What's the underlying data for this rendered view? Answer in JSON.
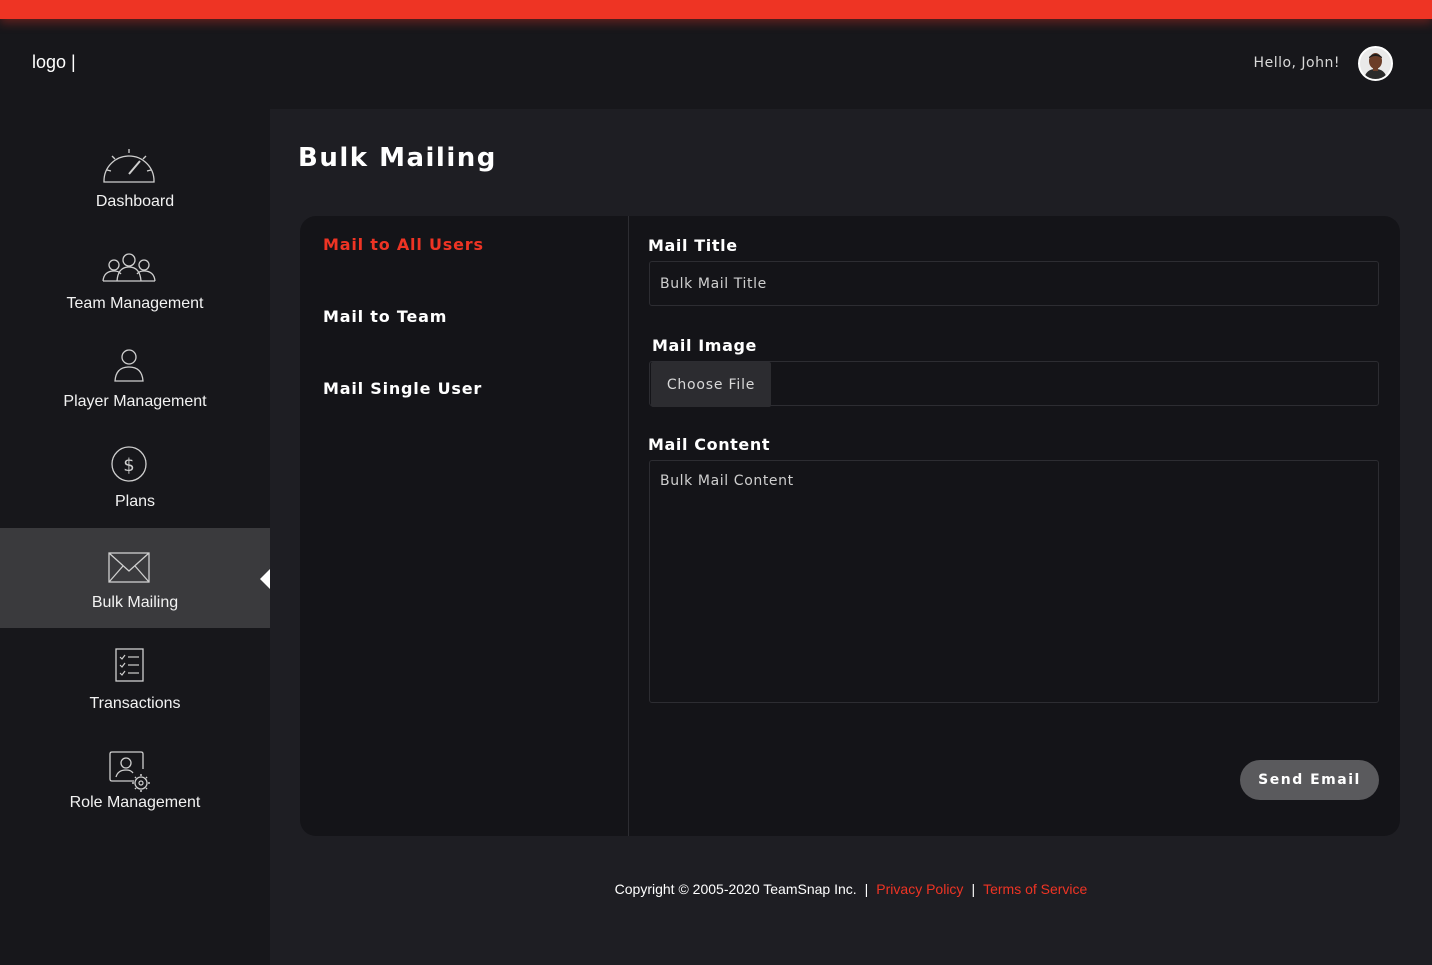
{
  "header": {
    "logo": "logo |",
    "greeting": "Hello, John!"
  },
  "sidebar": {
    "items": [
      {
        "label": "Dashboard",
        "icon": "speedometer-icon"
      },
      {
        "label": "Team Management",
        "icon": "group-icon"
      },
      {
        "label": "Player Management",
        "icon": "user-icon"
      },
      {
        "label": "Plans",
        "icon": "dollar-icon"
      },
      {
        "label": "Bulk Mailing",
        "icon": "envelope-icon",
        "active": true
      },
      {
        "label": "Transactions",
        "icon": "checklist-icon"
      },
      {
        "label": "Role Management",
        "icon": "user-settings-icon"
      }
    ]
  },
  "main": {
    "title": "Bulk Mailing",
    "tabs": [
      {
        "label": "Mail to All Users",
        "active": true
      },
      {
        "label": "Mail to Team"
      },
      {
        "label": "Mail Single User"
      }
    ],
    "form": {
      "title_label": "Mail Title",
      "title_placeholder": "Bulk Mail Title",
      "image_label": "Mail Image",
      "choose_file": "Choose File",
      "content_label": "Mail Content",
      "content_placeholder": "Bulk Mail Content",
      "send_button": "Send Email"
    }
  },
  "footer": {
    "copyright": "Copyright © 2005-2020 TeamSnap Inc.",
    "separator": "|",
    "privacy": "Privacy Policy",
    "terms": "Terms of Service"
  },
  "colors": {
    "accent": "#ee3424",
    "background": "#17171b",
    "panel": "#1e1e23",
    "card": "#141418",
    "active_nav": "#3a3a3d"
  }
}
